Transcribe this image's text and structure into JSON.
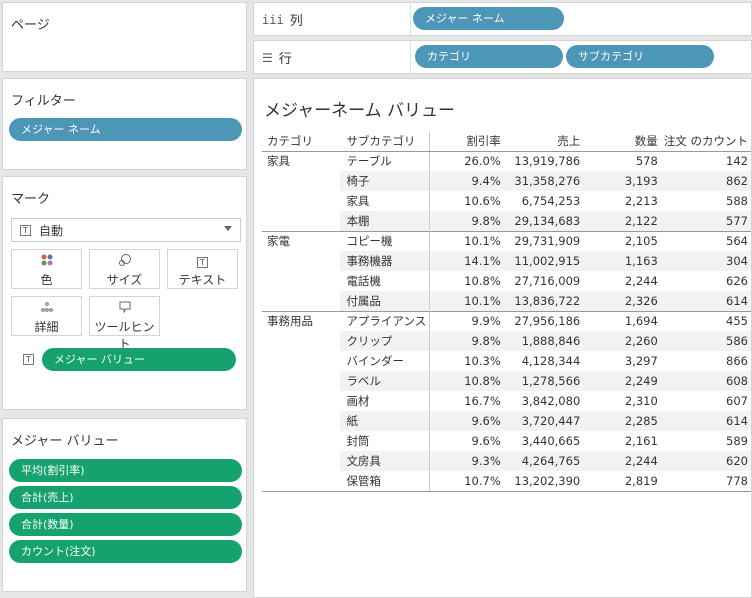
{
  "pages_card": {
    "title": "ページ"
  },
  "columns_shelf": {
    "label": "列",
    "icon": "iii",
    "pills": [
      "メジャー ネーム"
    ]
  },
  "rows_shelf": {
    "label": "行",
    "icon": "☰",
    "pills": [
      "カテゴリ",
      "サブカテゴリ"
    ]
  },
  "filters_card": {
    "title": "フィルター",
    "pills": [
      "メジャー ネーム"
    ]
  },
  "marks_card": {
    "title": "マーク",
    "mark_type": "自動",
    "buttons": {
      "color": "色",
      "size": "サイズ",
      "text": "テキスト",
      "detail": "詳細",
      "tooltip": "ツールヒント"
    },
    "field_pill": "メジャー バリュー"
  },
  "measure_values_card": {
    "title": "メジャー バリュー",
    "pills": [
      "平均(割引率)",
      "合計(売上)",
      "合計(数量)",
      "カウント(注文)"
    ]
  },
  "view": {
    "title": "メジャーネーム バリュー",
    "headers": [
      "カテゴリ",
      "サブカテゴリ",
      "割引率",
      "売上",
      "数量",
      "注文 のカウント"
    ],
    "rows": [
      {
        "cat": "家具",
        "sub": "テーブル",
        "disc": "26.0%",
        "sales": "13,919,786",
        "qty": "578",
        "cnt": "142"
      },
      {
        "cat": "",
        "sub": "椅子",
        "disc": "9.4%",
        "sales": "31,358,276",
        "qty": "3,193",
        "cnt": "862"
      },
      {
        "cat": "",
        "sub": "家具",
        "disc": "10.6%",
        "sales": "6,754,253",
        "qty": "2,213",
        "cnt": "588"
      },
      {
        "cat": "",
        "sub": "本棚",
        "disc": "9.8%",
        "sales": "29,134,683",
        "qty": "2,122",
        "cnt": "577"
      },
      {
        "cat": "家電",
        "sub": "コピー機",
        "disc": "10.1%",
        "sales": "29,731,909",
        "qty": "2,105",
        "cnt": "564"
      },
      {
        "cat": "",
        "sub": "事務機器",
        "disc": "14.1%",
        "sales": "11,002,915",
        "qty": "1,163",
        "cnt": "304"
      },
      {
        "cat": "",
        "sub": "電話機",
        "disc": "10.8%",
        "sales": "27,716,009",
        "qty": "2,244",
        "cnt": "626"
      },
      {
        "cat": "",
        "sub": "付属品",
        "disc": "10.1%",
        "sales": "13,836,722",
        "qty": "2,326",
        "cnt": "614"
      },
      {
        "cat": "事務用品",
        "sub": "アプライアンス",
        "disc": "9.9%",
        "sales": "27,956,186",
        "qty": "1,694",
        "cnt": "455"
      },
      {
        "cat": "",
        "sub": "クリップ",
        "disc": "9.8%",
        "sales": "1,888,846",
        "qty": "2,260",
        "cnt": "586"
      },
      {
        "cat": "",
        "sub": "バインダー",
        "disc": "10.3%",
        "sales": "4,128,344",
        "qty": "3,297",
        "cnt": "866"
      },
      {
        "cat": "",
        "sub": "ラベル",
        "disc": "10.8%",
        "sales": "1,278,566",
        "qty": "2,249",
        "cnt": "608"
      },
      {
        "cat": "",
        "sub": "画材",
        "disc": "16.7%",
        "sales": "3,842,080",
        "qty": "2,310",
        "cnt": "607"
      },
      {
        "cat": "",
        "sub": "紙",
        "disc": "9.6%",
        "sales": "3,720,447",
        "qty": "2,285",
        "cnt": "614"
      },
      {
        "cat": "",
        "sub": "封筒",
        "disc": "9.6%",
        "sales": "3,440,665",
        "qty": "2,161",
        "cnt": "589"
      },
      {
        "cat": "",
        "sub": "文房具",
        "disc": "9.3%",
        "sales": "4,264,765",
        "qty": "2,244",
        "cnt": "620"
      },
      {
        "cat": "",
        "sub": "保管箱",
        "disc": "10.7%",
        "sales": "13,202,390",
        "qty": "2,819",
        "cnt": "778"
      }
    ]
  },
  "colors": {
    "dimension_pill": "#4c96b8",
    "measure_pill": "#15a26f",
    "band": "#f2f2f2"
  }
}
